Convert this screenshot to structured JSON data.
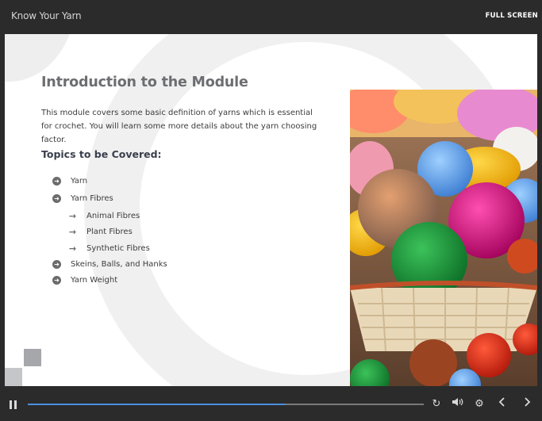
{
  "app": {
    "title": "Know Your Yarn",
    "fullscreen_label": "FULL SCREEN"
  },
  "slide": {
    "heading": "Introduction to the Module",
    "intro": "This module covers some basic definition of yarns which is essential for crochet. You will learn some more details about the yarn choosing factor.",
    "topics_title": "Topics to be Covered:",
    "topics": [
      {
        "label": "Yarn",
        "level": 1
      },
      {
        "label": "Yarn Fibres",
        "level": 1
      },
      {
        "label": "Animal Fibres",
        "level": 2
      },
      {
        "label": "Plant Fibres",
        "level": 2
      },
      {
        "label": "Synthetic Fibres",
        "level": 2
      },
      {
        "label": "Skeins, Balls, and Hanks",
        "level": 1
      },
      {
        "label": "Yarn Weight",
        "level": 1
      }
    ]
  },
  "player": {
    "progress_fraction": 0.65,
    "accent_color": "#4a90e2",
    "icons": [
      "pause-icon",
      "replay-icon",
      "volume-icon",
      "settings-icon",
      "previous-icon",
      "next-icon"
    ]
  }
}
